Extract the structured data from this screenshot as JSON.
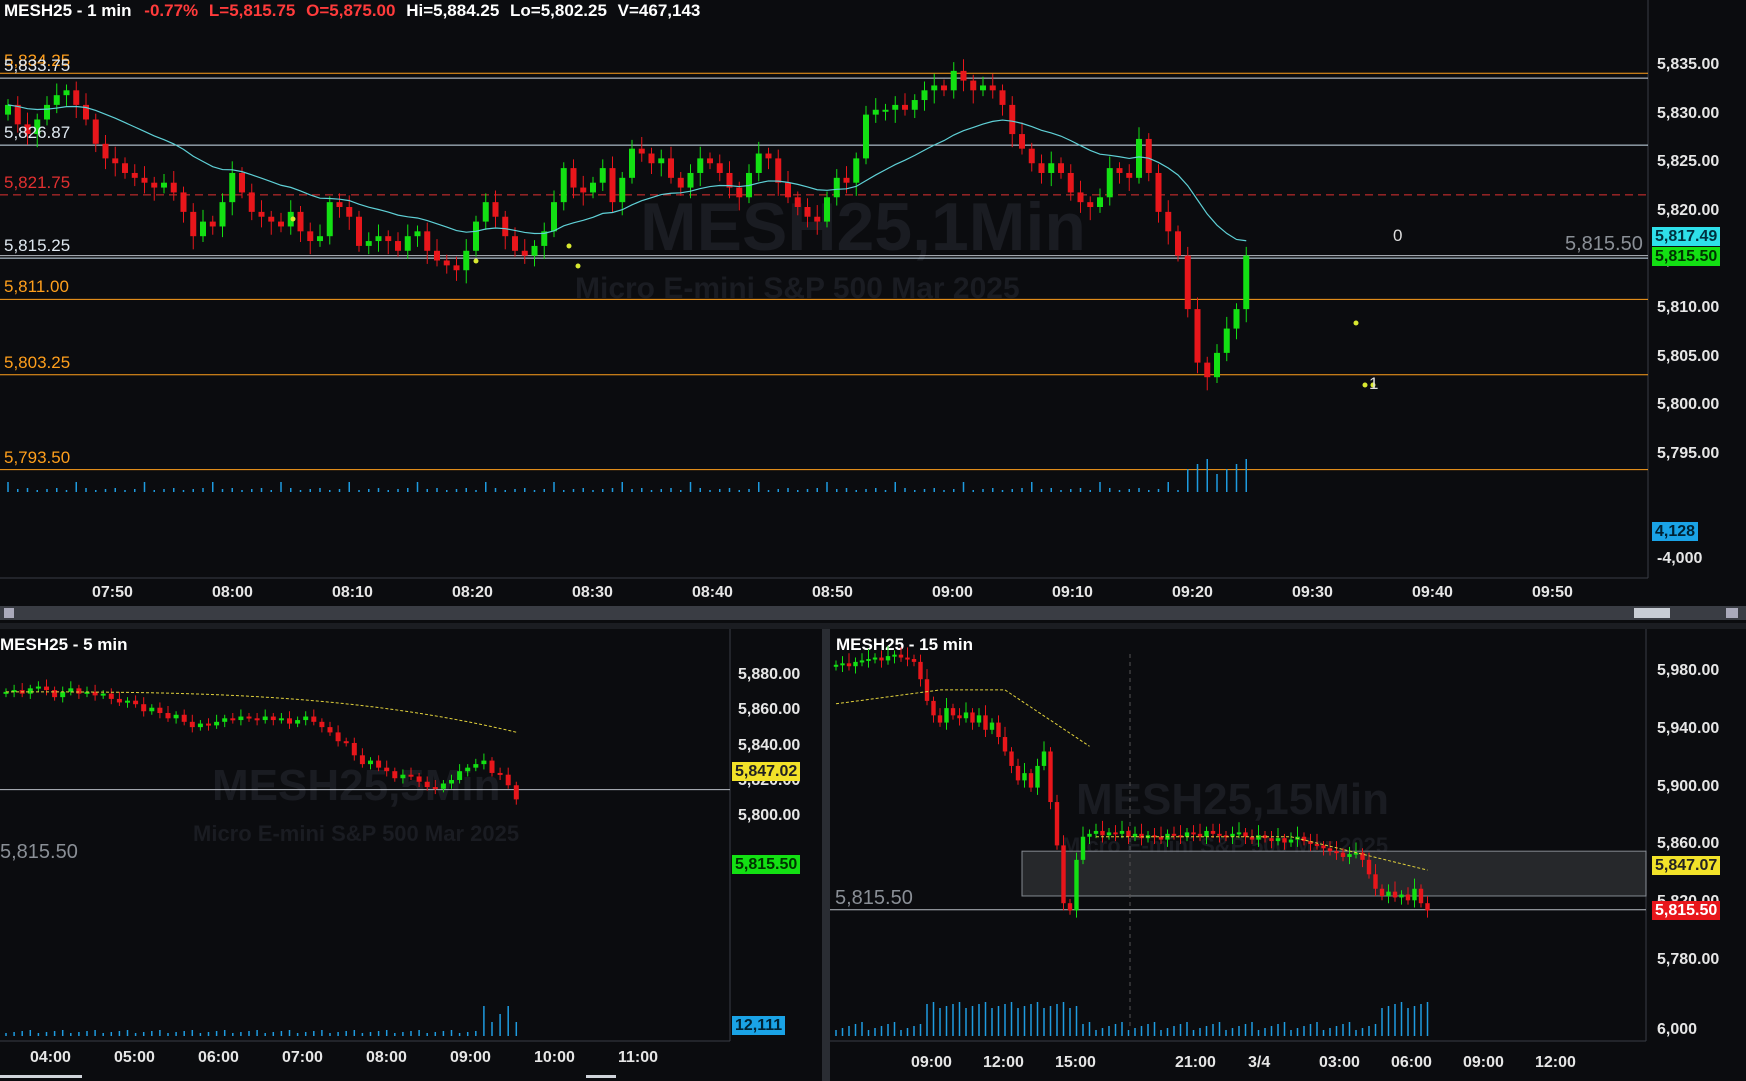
{
  "top": {
    "header": {
      "symbol": "MESH25 - 1 min",
      "change": "-0.77%",
      "last": "L=5,815.75",
      "open": "O=5,875.00",
      "high": "Hi=5,884.25",
      "low": "Lo=5,802.25",
      "volume": "V=467,143"
    },
    "watermark": {
      "title": "MESH25,1Min",
      "subtitle": "Micro E-mini S&P 500 Mar 2025"
    },
    "levels": [
      {
        "label": "5,834.25",
        "value": 5834.25,
        "color": "#ff9f1c",
        "style": "solid"
      },
      {
        "label": "5,833.75",
        "value": 5833.75,
        "color": "#cfd8e3",
        "style": "solid"
      },
      {
        "label": "5,826.87",
        "value": 5826.87,
        "color": "#cfe3f0",
        "style": "solid"
      },
      {
        "label": "5,821.75",
        "value": 5821.75,
        "color": "#e03030",
        "style": "dashed"
      },
      {
        "label": "5,815.25",
        "value": 5815.25,
        "color": "#cfe3f0",
        "style": "solid"
      },
      {
        "label": "5,811.00",
        "value": 5811.0,
        "color": "#ff9f1c",
        "style": "solid"
      },
      {
        "label": "5,803.25",
        "value": 5803.25,
        "color": "#ff9f1c",
        "style": "solid"
      },
      {
        "label": "5,793.50",
        "value": 5793.5,
        "color": "#ff9f1c",
        "style": "solid"
      }
    ],
    "price_axis": [
      "5,835.00",
      "5,830.00",
      "5,825.00",
      "5,820.00",
      "5,815.00",
      "5,810.00",
      "5,805.00",
      "5,800.00",
      "5,795.00"
    ],
    "time_axis": [
      "07:50",
      "08:00",
      "08:10",
      "08:20",
      "08:30",
      "08:40",
      "08:50",
      "09:00",
      "09:10",
      "09:20",
      "09:30",
      "09:40",
      "09:50"
    ],
    "ema_tag": "5,817.49",
    "last_tag": "5,815.50",
    "last_line_label": "5,815.50",
    "volume_tag": "4,128",
    "volume_axis": "-4,000",
    "marker_top": "0",
    "marker_bottom": "1"
  },
  "bottom_left": {
    "header": {
      "symbol": "MESH25 - 5 min"
    },
    "watermark": {
      "title": "MESH25,5Min",
      "subtitle": "Micro E-mini S&P 500 Mar 2025"
    },
    "price_axis": [
      "5,880.00",
      "5,860.00",
      "5,840.00",
      "5,820.00",
      "5,800.00"
    ],
    "time_axis": [
      "04:00",
      "05:00",
      "06:00",
      "07:00",
      "08:00",
      "09:00",
      "10:00",
      "11:00"
    ],
    "ema_tag": "5,847.02",
    "last_tag": "5,815.50",
    "last_line_label": "5,815.50",
    "volume_tag": "12,111"
  },
  "bottom_right": {
    "header": {
      "symbol": "MESH25 - 15 min"
    },
    "watermark": {
      "title": "MESH25,15Min",
      "subtitle": "Micro E-mini S&P 500 Mar 2025"
    },
    "price_axis": [
      "5,980.00",
      "5,940.00",
      "5,900.00",
      "5,860.00",
      "5,820.00",
      "5,780.00"
    ],
    "time_axis": [
      "09:00",
      "12:00",
      "15:00",
      "21:00",
      "3/4",
      "03:00",
      "06:00",
      "09:00",
      "12:00"
    ],
    "ema_tag": "5,847.07",
    "last_tag": "5,815.50",
    "last_line_label": "5,815.50",
    "volume_axis": "6,000"
  },
  "colors": {
    "up": "#13e013",
    "down": "#e8161b",
    "ema_top": "#5fd0d6",
    "ema_bottom": "#e1d13c",
    "volume": "#1e9be0",
    "bg": "#0b0c0f"
  }
}
